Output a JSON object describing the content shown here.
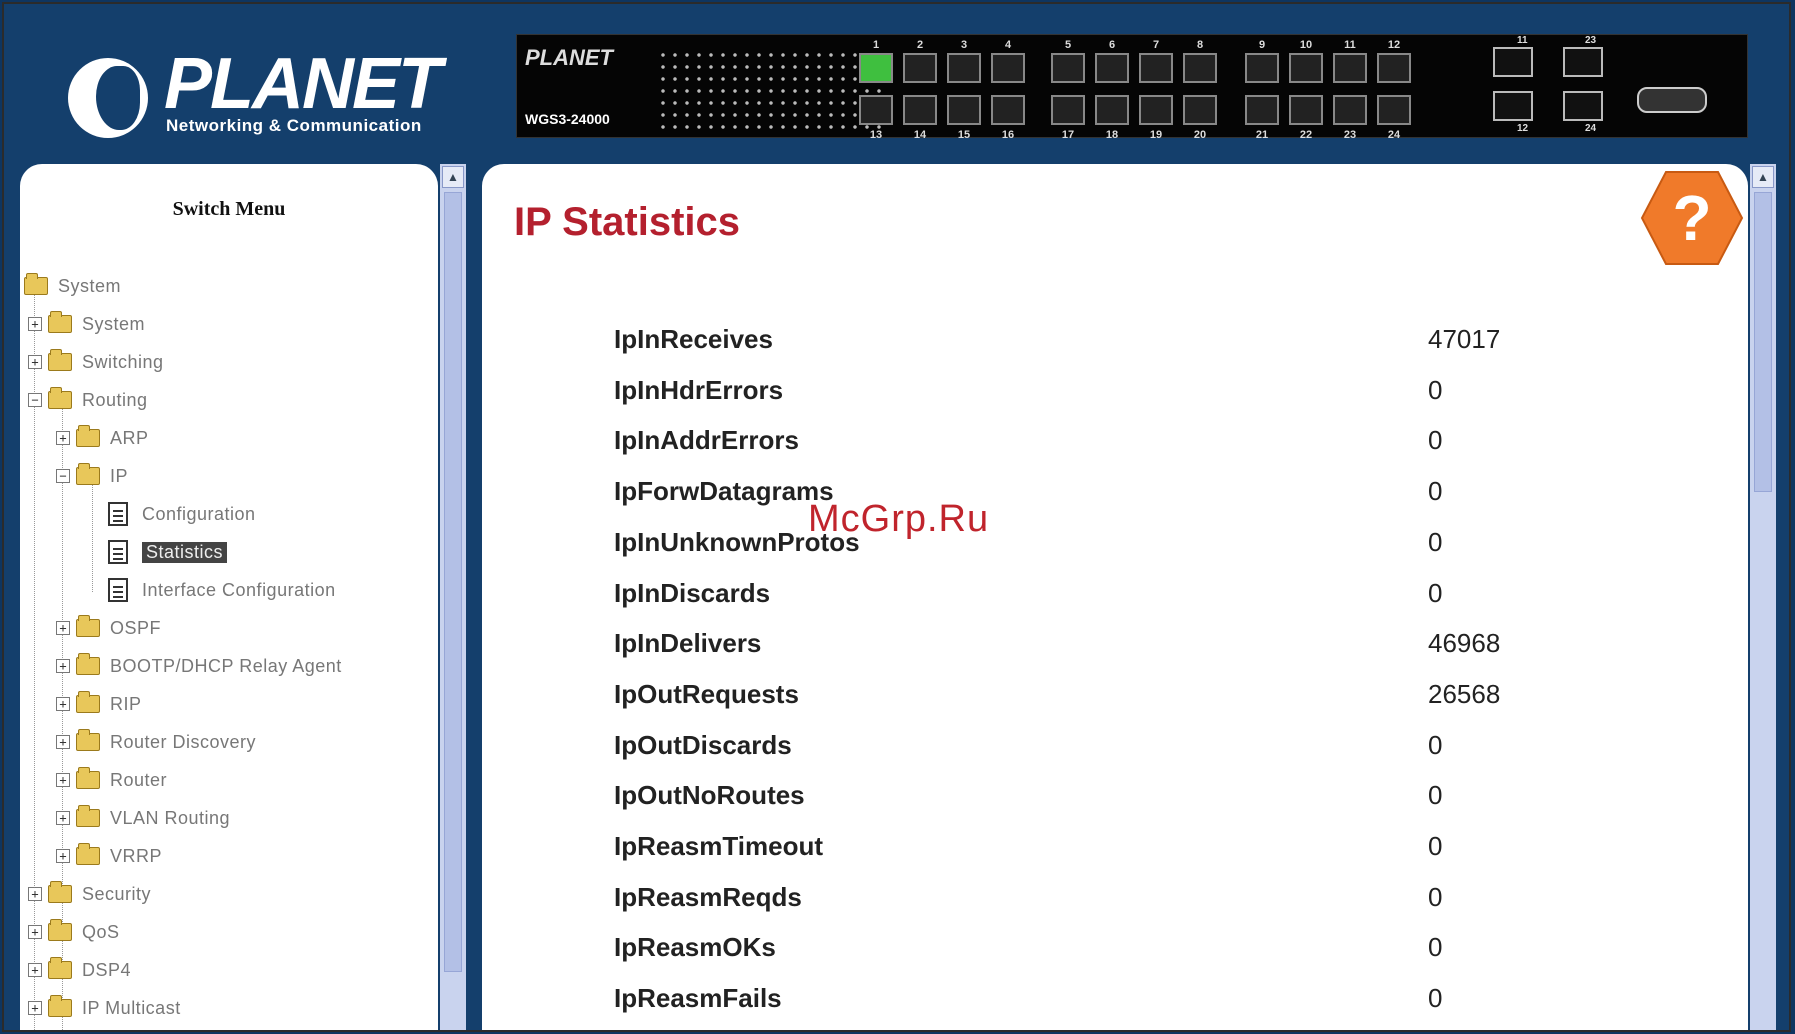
{
  "brand": {
    "name": "PLANET",
    "tagline": "Networking & Communication"
  },
  "device": {
    "panel_logo": "PLANET",
    "model": "WGS3-24000",
    "ports_top_group1": [
      "1",
      "2",
      "3",
      "4"
    ],
    "ports_top_group2": [
      "5",
      "6",
      "7",
      "8"
    ],
    "ports_top_group3": [
      "9",
      "10",
      "11",
      "12"
    ],
    "ports_bottom_group1": [
      "13",
      "14",
      "15",
      "16"
    ],
    "ports_bottom_group2": [
      "17",
      "18",
      "19",
      "20"
    ],
    "ports_bottom_group3": [
      "21",
      "22",
      "23",
      "24"
    ],
    "sfp_labels": [
      "11",
      "23",
      "12",
      "24"
    ]
  },
  "menu": {
    "title": "Switch Menu",
    "items": [
      {
        "label": "System"
      },
      {
        "label": "System"
      },
      {
        "label": "Switching"
      },
      {
        "label": "Routing"
      },
      {
        "label": "ARP"
      },
      {
        "label": "IP"
      },
      {
        "label": "Configuration"
      },
      {
        "label": "Statistics"
      },
      {
        "label": "Interface Configuration"
      },
      {
        "label": "OSPF"
      },
      {
        "label": "BOOTP/DHCP Relay Agent"
      },
      {
        "label": "RIP"
      },
      {
        "label": "Router Discovery"
      },
      {
        "label": "Router"
      },
      {
        "label": "VLAN Routing"
      },
      {
        "label": "VRRP"
      },
      {
        "label": "Security"
      },
      {
        "label": "QoS"
      },
      {
        "label": "DSP4"
      },
      {
        "label": "IP Multicast"
      }
    ]
  },
  "page": {
    "title": "IP Statistics",
    "help_icon": "question-hexagon-icon"
  },
  "stats": [
    {
      "key": "IpInReceives",
      "value": "47017"
    },
    {
      "key": "IpInHdrErrors",
      "value": "0"
    },
    {
      "key": "IpInAddrErrors",
      "value": "0"
    },
    {
      "key": "IpForwDatagrams",
      "value": "0"
    },
    {
      "key": "IpInUnknownProtos",
      "value": "0"
    },
    {
      "key": "IpInDiscards",
      "value": "0"
    },
    {
      "key": "IpInDelivers",
      "value": "46968"
    },
    {
      "key": "IpOutRequests",
      "value": "26568"
    },
    {
      "key": "IpOutDiscards",
      "value": "0"
    },
    {
      "key": "IpOutNoRoutes",
      "value": "0"
    },
    {
      "key": "IpReasmTimeout",
      "value": "0"
    },
    {
      "key": "IpReasmReqds",
      "value": "0"
    },
    {
      "key": "IpReasmOKs",
      "value": "0"
    },
    {
      "key": "IpReasmFails",
      "value": "0"
    }
  ],
  "watermark": "McGrp.Ru",
  "colors": {
    "header_bg": "#143f6c",
    "title_red": "#b4202e",
    "help_orange": "#f07a2a",
    "port_active": "#3fbf3f"
  }
}
